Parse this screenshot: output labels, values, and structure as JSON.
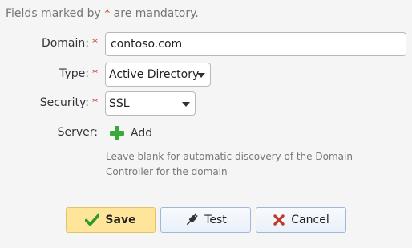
{
  "note": {
    "prefix": "Fields marked by ",
    "star": "*",
    "suffix": " are mandatory."
  },
  "form": {
    "domain": {
      "label": "Domain:",
      "required": "*",
      "value": "contoso.com"
    },
    "type": {
      "label": "Type:",
      "required": "*",
      "selected": "Active Directory"
    },
    "security": {
      "label": "Security:",
      "required": "*",
      "selected": "SSL"
    },
    "server": {
      "label": "Server:",
      "add_label": "Add",
      "hint": "Leave blank for automatic discovery of the Domain Controller for the domain"
    }
  },
  "buttons": {
    "save": "Save",
    "test": "Test",
    "cancel": "Cancel"
  },
  "icons": {
    "add": "plus-icon",
    "save": "checkmark-icon",
    "test": "plug-icon",
    "cancel": "x-icon"
  },
  "colors": {
    "required_star": "#c0392b",
    "add_plus": "#3aa83a",
    "save_background": "#ffe59a",
    "check_green": "#2e9a2e",
    "cancel_red": "#c0392b"
  }
}
